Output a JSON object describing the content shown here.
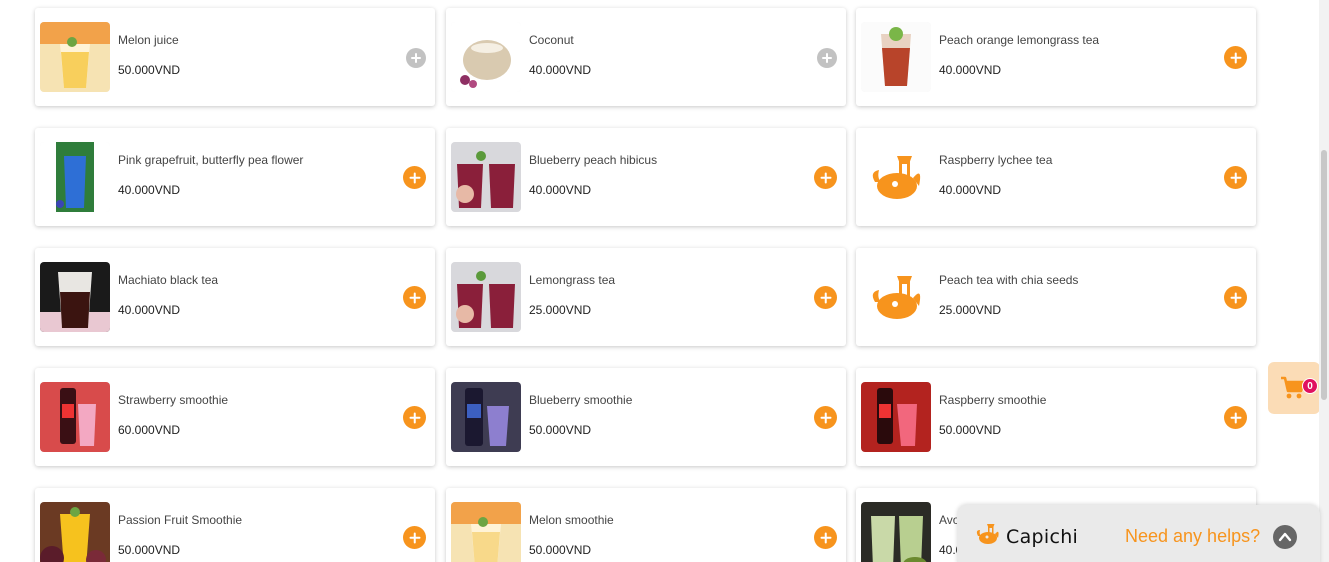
{
  "products": [
    {
      "name": "Melon juice",
      "price": "50.000VND",
      "image": "melon-juice",
      "available": false
    },
    {
      "name": "Coconut",
      "price": "40.000VND",
      "image": "coconut",
      "available": false
    },
    {
      "name": "Peach orange lemongrass tea",
      "price": "40.000VND",
      "image": "peach-orange-tea",
      "available": true
    },
    {
      "name": "Pink grapefruit, butterfly pea flower",
      "price": "40.000VND",
      "image": "butterfly-pea",
      "available": true
    },
    {
      "name": "Blueberry peach hibicus",
      "price": "40.000VND",
      "image": "hibiscus",
      "available": true
    },
    {
      "name": "Raspberry lychee tea",
      "price": "40.000VND",
      "image": "capichi-logo",
      "available": true
    },
    {
      "name": "Machiato black tea",
      "price": "40.000VND",
      "image": "machiato",
      "available": true
    },
    {
      "name": "Lemongrass tea",
      "price": "25.000VND",
      "image": "hibiscus",
      "available": true
    },
    {
      "name": "Peach tea with chia seeds",
      "price": "25.000VND",
      "image": "capichi-logo",
      "available": true
    },
    {
      "name": "Strawberry smoothie",
      "price": "60.000VND",
      "image": "strawberry-smoothie",
      "available": true
    },
    {
      "name": "Blueberry smoothie",
      "price": "50.000VND",
      "image": "blueberry-smoothie",
      "available": true
    },
    {
      "name": "Raspberry smoothie",
      "price": "50.000VND",
      "image": "raspberry-smoothie",
      "available": true
    },
    {
      "name": "Passion Fruit Smoothie",
      "price": "50.000VND",
      "image": "passion-fruit",
      "available": true
    },
    {
      "name": "Melon smoothie",
      "price": "50.000VND",
      "image": "melon-juice",
      "available": true
    },
    {
      "name": "Avo",
      "price": "40.0",
      "image": "avocado",
      "available": true
    }
  ],
  "cart": {
    "count": "0",
    "icon": "cart-icon"
  },
  "help": {
    "brand": "Capichi",
    "text": "Need any helps?",
    "icon": "chevron-up-icon"
  },
  "colors": {
    "accent": "#f7941d",
    "disabled": "#c2c2c2",
    "badge": "#e0115f",
    "cart_bg": "#fbdcb6"
  }
}
